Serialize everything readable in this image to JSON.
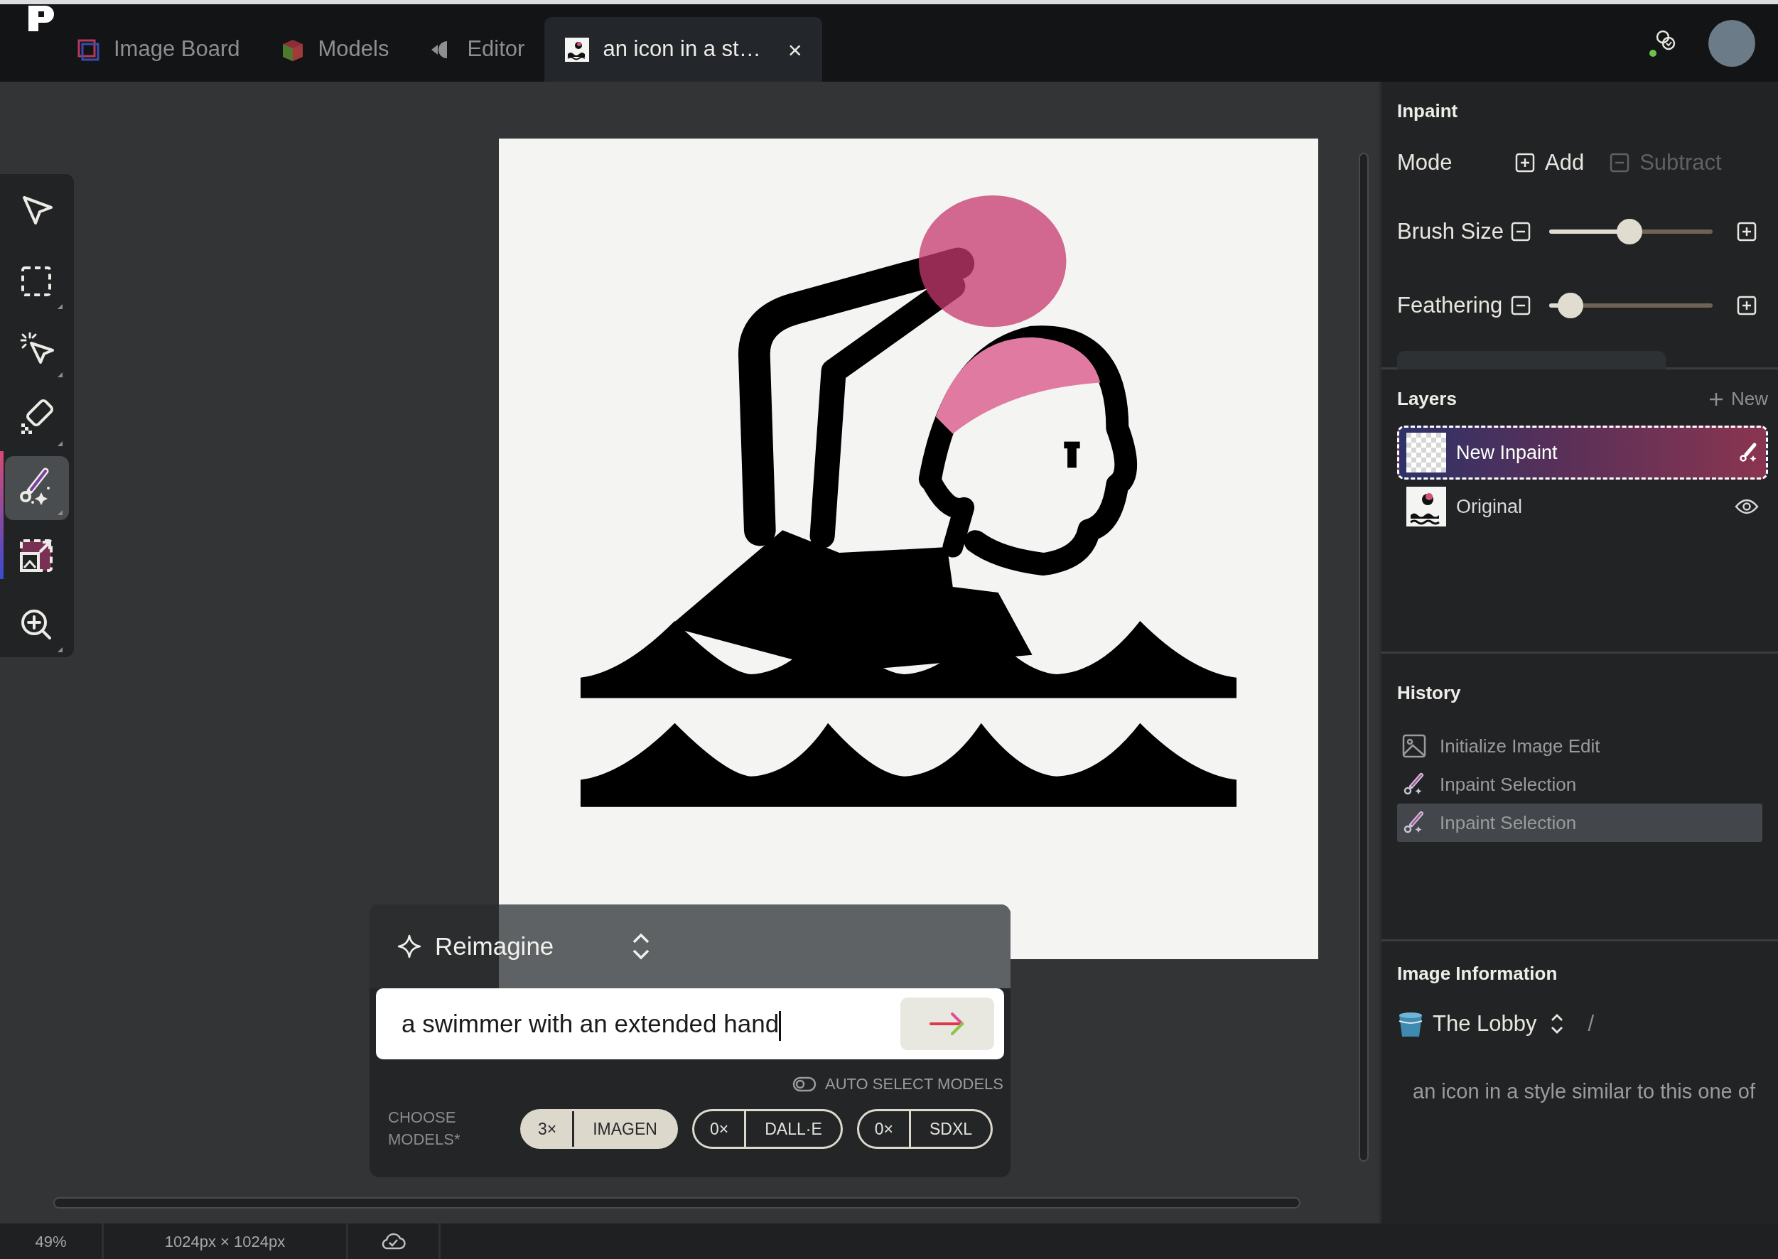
{
  "top_bar": {
    "tabs": [
      {
        "label": "Image Board",
        "kind": "board",
        "selected": false
      },
      {
        "label": "Models",
        "kind": "models",
        "selected": false
      },
      {
        "label": "Editor",
        "kind": "editor",
        "selected": false
      },
      {
        "label": "an icon in a st…",
        "kind": "document",
        "selected": true,
        "close": "×"
      }
    ]
  },
  "toolbar": {
    "tools": [
      {
        "kind": "select",
        "selected": false
      },
      {
        "kind": "marquee",
        "selected": false
      },
      {
        "kind": "magic-select",
        "selected": false
      },
      {
        "kind": "eraser",
        "selected": false
      },
      {
        "kind": "inpaint",
        "selected": true
      },
      {
        "kind": "outpaint",
        "selected": false
      },
      {
        "kind": "zoom",
        "selected": false
      }
    ]
  },
  "prompt": {
    "mode": "Reimagine",
    "value": "a swimmer with an extended hand",
    "auto_select": {
      "label": "AUTO SELECT MODELS",
      "on": false
    },
    "choose_label": "CHOOSE MODELS*",
    "models": [
      {
        "count": "3×",
        "name": "IMAGEN",
        "selected": true
      },
      {
        "count": "0×",
        "name": "DALL·E",
        "selected": false
      },
      {
        "count": "0×",
        "name": "SDXL",
        "selected": false
      }
    ]
  },
  "inpaint": {
    "title": "Inpaint",
    "mode_label": "Mode",
    "modes": [
      {
        "label": "Add",
        "kind": "add",
        "selected": true
      },
      {
        "label": "Subtract",
        "kind": "subtract",
        "selected": false
      }
    ],
    "sliders": [
      {
        "label": "Brush Size",
        "level": 0.49
      },
      {
        "label": "Feathering",
        "level": 0.13
      }
    ]
  },
  "layers": {
    "title": "Layers",
    "new_label": "New",
    "items": [
      {
        "name": "New Inpaint",
        "kind": "inpaint",
        "selected": true
      },
      {
        "name": "Original",
        "kind": "image",
        "selected": false
      }
    ]
  },
  "history": {
    "title": "History",
    "items": [
      {
        "label": "Initialize Image Edit",
        "kind": "image",
        "selected": false
      },
      {
        "label": "Inpaint Selection",
        "kind": "inpaint",
        "selected": false
      },
      {
        "label": "Inpaint Selection",
        "kind": "inpaint",
        "selected": true
      }
    ]
  },
  "image_information": {
    "title": "Image Information",
    "collection": "The Lobby",
    "separator": "/",
    "description": "an icon in a style similar to this one of"
  },
  "status_bar": {
    "zoom": "49%",
    "dimensions": "1024px × 1024px"
  }
}
